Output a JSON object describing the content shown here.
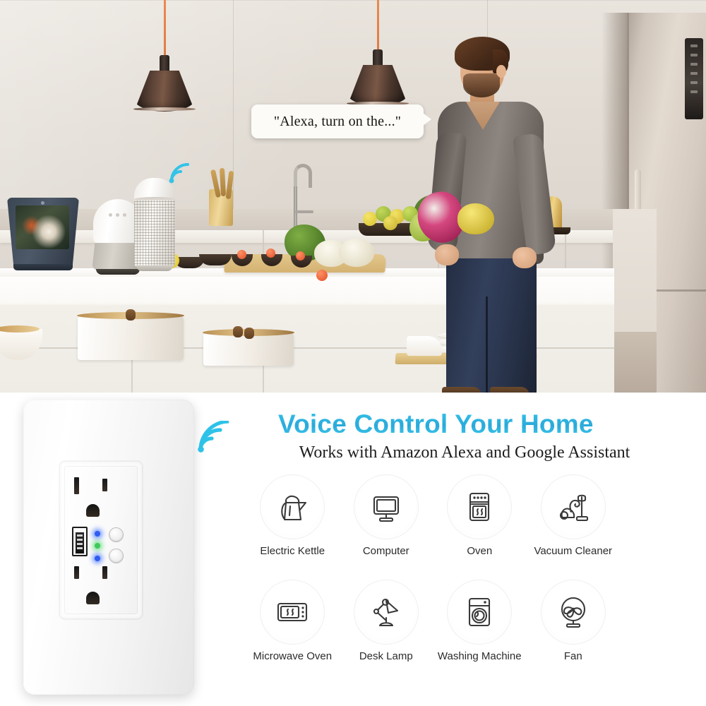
{
  "scene": {
    "speech_bubble_text": "\"Alexa, turn on the...\"",
    "devices": [
      {
        "name": "echo-show",
        "label": "Amazon Echo Show"
      },
      {
        "name": "google-home",
        "label": "Google Home"
      },
      {
        "name": "amazon-echo",
        "label": "Amazon Echo"
      }
    ],
    "wifi_icon": "wifi-icon",
    "colors": {
      "wall": "#e4ded6",
      "counter": "#ffffff",
      "pendant_shade": "#3e2a20",
      "pendant_cord": "#e07a42",
      "sweater": "#807872",
      "jeans": "#2b364f",
      "fridge": "#d2c8be"
    }
  },
  "product": {
    "name": "smart-wall-outlet",
    "leds": [
      {
        "name": "led-wifi",
        "color": "#2f5df0"
      },
      {
        "name": "led-power",
        "color": "#3ec95a"
      },
      {
        "name": "led-usb",
        "color": "#2f5df0"
      }
    ],
    "buttons": [
      {
        "name": "outlet-button-upper"
      },
      {
        "name": "outlet-button-lower"
      }
    ],
    "ports": [
      "usb-port",
      "socket-top",
      "socket-bottom"
    ]
  },
  "headline": {
    "title": "Voice Control Your Home",
    "subtitle": "Works with Amazon Alexa and Google Assistant",
    "title_color": "#2fbde8",
    "subtitle_color": "#1d1d1d",
    "wifi_icon": "wifi-icon"
  },
  "appliances": [
    {
      "label": "Electric Kettle",
      "icon": "electric-kettle-icon"
    },
    {
      "label": "Computer",
      "icon": "computer-monitor-icon"
    },
    {
      "label": "Oven",
      "icon": "oven-icon"
    },
    {
      "label": "Vacuum Cleaner",
      "icon": "vacuum-cleaner-icon"
    },
    {
      "label": "Microwave Oven",
      "icon": "microwave-oven-icon"
    },
    {
      "label": "Desk Lamp",
      "icon": "desk-lamp-icon"
    },
    {
      "label": "Washing Machine",
      "icon": "washing-machine-icon"
    },
    {
      "label": "Fan",
      "icon": "fan-icon"
    }
  ]
}
